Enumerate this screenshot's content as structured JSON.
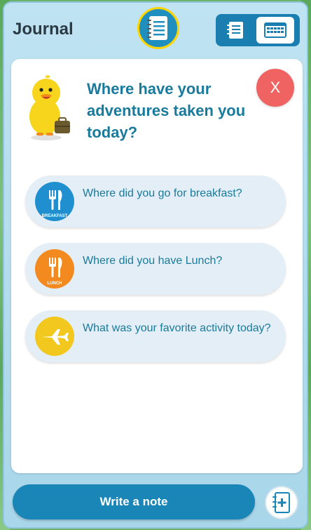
{
  "header": {
    "title": "Journal",
    "journal_icon": "notebook-icon",
    "views": [
      {
        "name": "list-view",
        "icon": "list-icon",
        "selected": false
      },
      {
        "name": "calendar-view",
        "icon": "calendar-icon",
        "selected": true
      }
    ]
  },
  "card": {
    "headline": "Where have your adventures taken you today?",
    "close_label": "X",
    "mascot_icon": "duck-with-suitcase-icon",
    "prompts": [
      {
        "text": "Where did you go for breakfast?",
        "badge_text": "BREAKFAST",
        "icon": "fork-knife-icon",
        "color": "#1f8fcf"
      },
      {
        "text": "Where did you have Lunch?",
        "badge_text": "LUNCH",
        "icon": "fork-knife-icon",
        "color": "#f28a1f"
      },
      {
        "text": "What was your favorite activity today?",
        "badge_text": "",
        "icon": "airplane-icon",
        "color": "#f2c81f"
      }
    ]
  },
  "footer": {
    "write_label": "Write a note",
    "add_icon": "add-note-icon"
  },
  "colors": {
    "accent": "#1a86b8",
    "text_accent": "#1a7a9c",
    "close": "#f06363",
    "badge_border": "#ffd400"
  }
}
